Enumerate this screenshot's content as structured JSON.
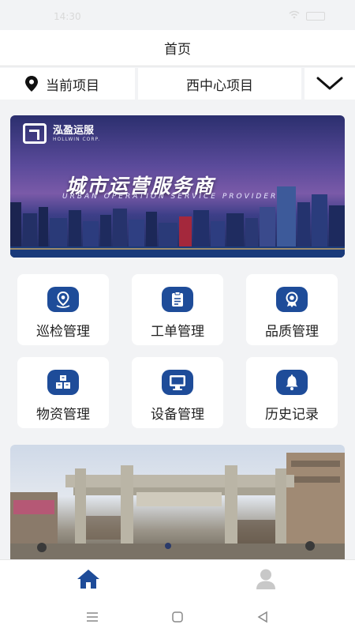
{
  "status_bar": {
    "time": "14:30",
    "signal": "wifi-icon",
    "battery": "battery-icon"
  },
  "header": {
    "title": "首页"
  },
  "project": {
    "label": "当前项目",
    "value": "西中心项目"
  },
  "banner": {
    "logo_name": "泓盈运服",
    "logo_sub": "HOLLWIN CORP.",
    "headline": "城市运营服务商",
    "subline": "URBAN OPERATION SERVICE PROVIDER"
  },
  "menu": [
    {
      "label": "巡检管理",
      "icon": "location-pin-icon"
    },
    {
      "label": "工单管理",
      "icon": "clipboard-icon"
    },
    {
      "label": "品质管理",
      "icon": "award-badge-icon"
    },
    {
      "label": "物资管理",
      "icon": "boxes-icon"
    },
    {
      "label": "设备管理",
      "icon": "monitor-icon"
    },
    {
      "label": "历史记录",
      "icon": "bell-icon"
    }
  ],
  "tabs": [
    {
      "name": "home",
      "icon": "home-icon",
      "active": true
    },
    {
      "name": "profile",
      "icon": "user-icon",
      "active": false
    }
  ],
  "colors": {
    "accent": "#1e4c99",
    "inactive": "#c8c8c8",
    "background": "#f2f3f5"
  }
}
